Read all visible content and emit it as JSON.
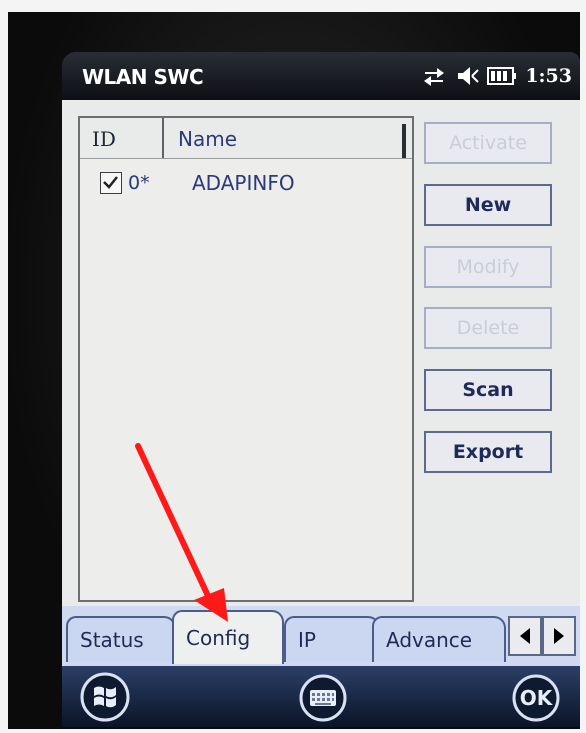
{
  "window": {
    "title": "WLAN SWC",
    "clock": "1:53"
  },
  "list": {
    "columns": [
      "ID",
      "Name"
    ],
    "rows": [
      {
        "checked": true,
        "id": "0*",
        "name": "ADAPINFO"
      }
    ]
  },
  "buttons": {
    "activate": "Activate",
    "new": "New",
    "modify": "Modify",
    "delete": "Delete",
    "scan": "Scan",
    "export": "Export"
  },
  "tabs": [
    "Status",
    "Config",
    "IP",
    "Advance"
  ],
  "active_tab": "Config",
  "softkeys": {
    "ok": "OK"
  },
  "icons": [
    "connectivity-icon",
    "volume-icon",
    "battery-icon",
    "start-icon",
    "keyboard-icon"
  ],
  "colors": {
    "accent_arrow": "#ff1a1a",
    "titlebar": "#0d0f14"
  }
}
